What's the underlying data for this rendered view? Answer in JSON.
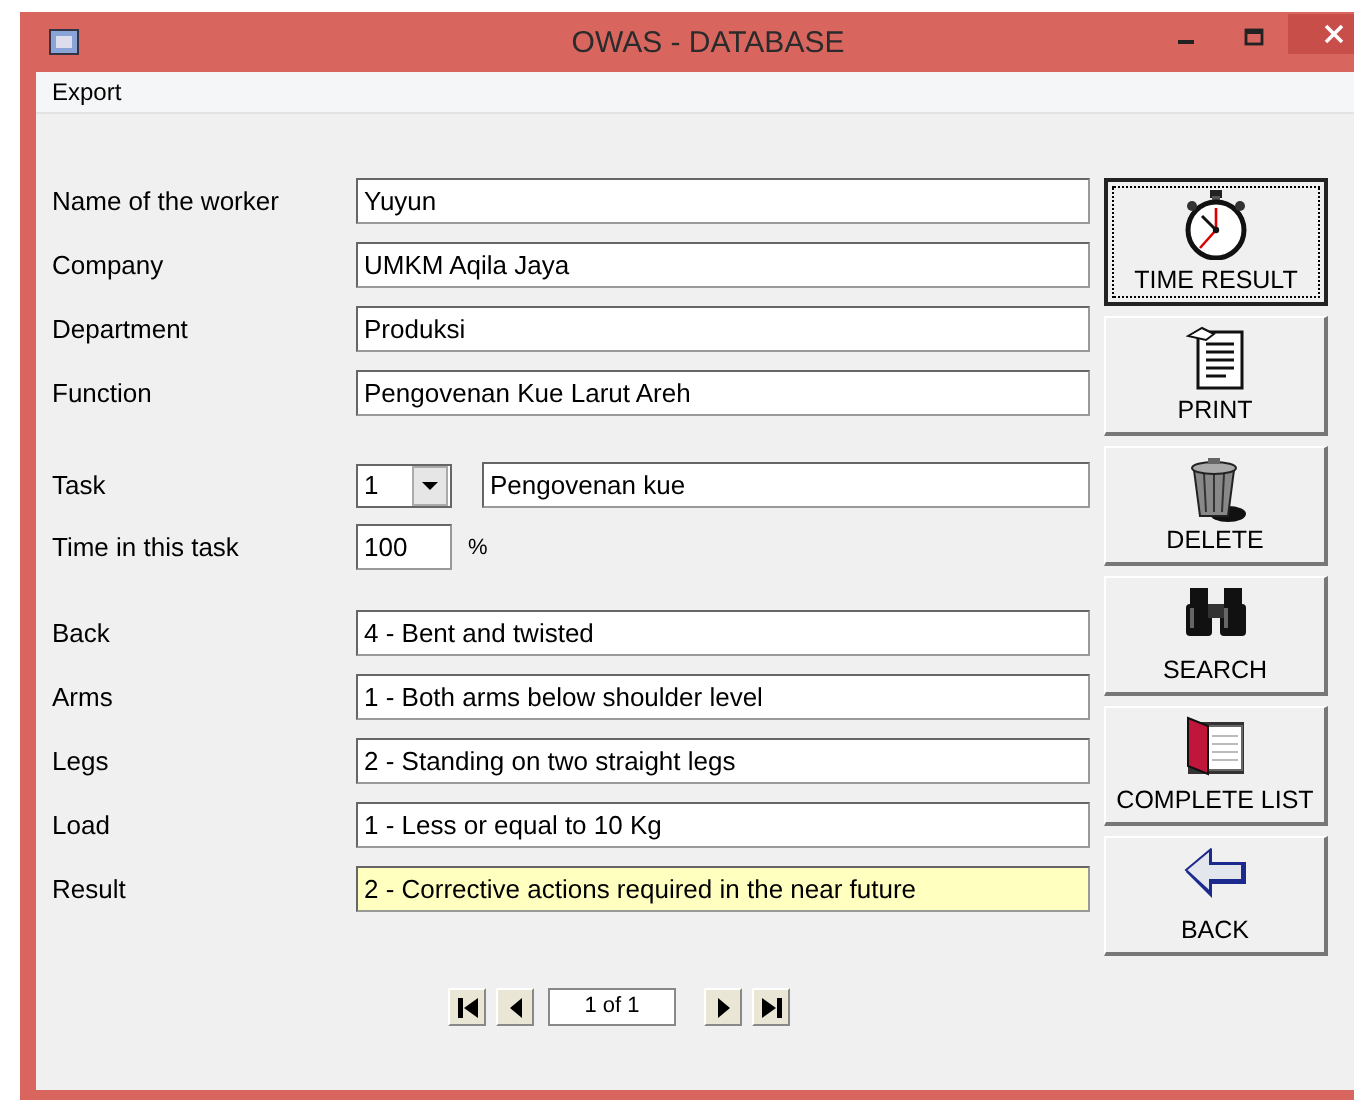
{
  "window": {
    "title": "OWAS - DATABASE"
  },
  "menu": [
    "Export"
  ],
  "worker_fields": [
    {
      "label": "Name of the worker",
      "value": "Yuyun"
    },
    {
      "label": "Company",
      "value": "UMKM Aqila Jaya"
    },
    {
      "label": "Department",
      "value": "Produksi"
    },
    {
      "label": "Function",
      "value": "Pengovenan Kue Larut Areh"
    }
  ],
  "task": {
    "label": "Task",
    "number": "1",
    "description": "Pengovenan kue"
  },
  "time": {
    "label": "Time in this task",
    "value": "100",
    "unit": "%"
  },
  "posture_fields": [
    {
      "label": "Back",
      "value": "4 - Bent and twisted",
      "highlighted": false
    },
    {
      "label": "Arms",
      "value": "1 - Both arms below shoulder level",
      "highlighted": false
    },
    {
      "label": "Legs",
      "value": "2 - Standing on two straight legs",
      "highlighted": false
    },
    {
      "label": "Load",
      "value": "1 - Less or equal to 10 Kg",
      "highlighted": false
    },
    {
      "label": "Result",
      "value": "2 - Corrective actions required in the near future",
      "highlighted": true
    }
  ],
  "buttons": [
    {
      "label": "TIME RESULT",
      "kind": "stopwatch",
      "focused": true
    },
    {
      "label": "PRINT",
      "kind": "print",
      "focused": false
    },
    {
      "label": "DELETE",
      "kind": "trash",
      "focused": false
    },
    {
      "label": "SEARCH",
      "kind": "binoculars",
      "focused": false
    },
    {
      "label": "COMPLETE LIST",
      "kind": "book",
      "focused": false
    },
    {
      "label": "BACK",
      "kind": "back",
      "focused": false
    }
  ],
  "navigator": {
    "record": "1 of 1",
    "buttons": [
      {
        "kind": "first"
      },
      {
        "kind": "prev"
      },
      {
        "kind": "next"
      },
      {
        "kind": "last"
      }
    ]
  }
}
